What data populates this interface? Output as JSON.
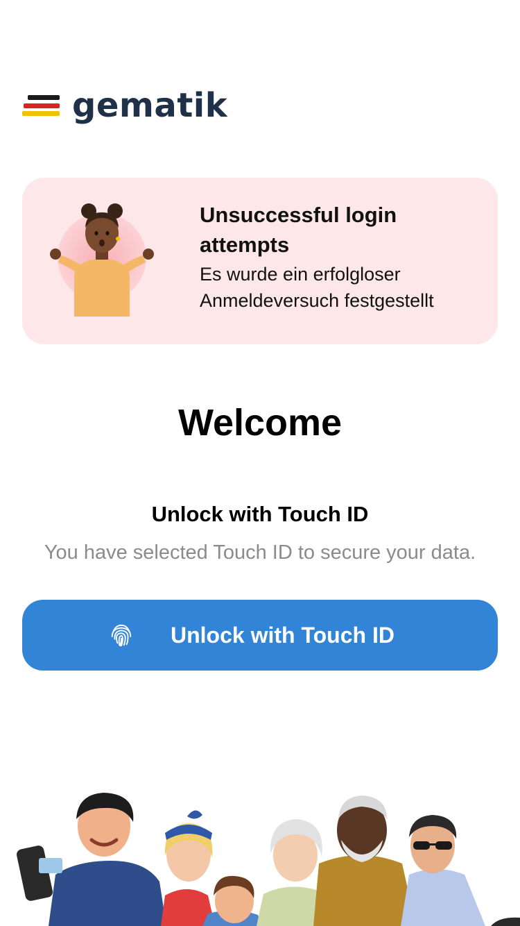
{
  "brand": {
    "logo_text": "gematik",
    "colors": {
      "stripe_black": "#1a1a1a",
      "stripe_red": "#d8261d",
      "stripe_gold": "#f2c100",
      "text": "#1f3149"
    }
  },
  "alert": {
    "title": "Unsuccessful login attempts",
    "body": "Es wurde ein erfolgloser Anmeldeversuch festgestellt",
    "background": "#fde7e8",
    "illustration": "shrugging-person-illustration"
  },
  "welcome": {
    "title": "Welcome",
    "unlock_heading": "Unlock with Touch ID",
    "unlock_description": "You have selected Touch ID to secure your data."
  },
  "unlock_button": {
    "label": "Unlock with Touch ID",
    "icon": "fingerprint-icon",
    "color": "#3285d6"
  },
  "footer": {
    "illustration": "group-of-people-illustration"
  }
}
